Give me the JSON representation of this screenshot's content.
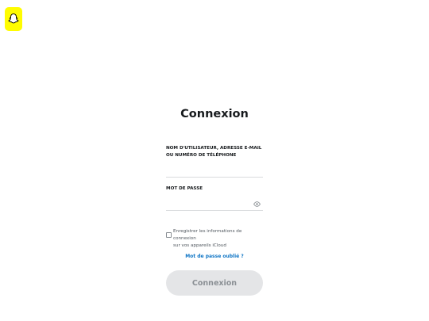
{
  "brand": {
    "icon": "snapchat-ghost-icon",
    "color": "#fffc00"
  },
  "title": "Connexion",
  "username": {
    "label_line1": "NOM D'UTILISATEUR, ADRESSE E-MAIL",
    "label_line2": "OU NUMÉRO DE TÉLÉPHONE",
    "value": ""
  },
  "password": {
    "label": "MOT DE PASSE",
    "value": "",
    "toggle_icon": "eye-icon"
  },
  "remember": {
    "checked": false,
    "label_line1": "Enregistrer les informations de connexion",
    "label_line2": "sur vos appareils iCloud"
  },
  "forgot_link": "Mot de passe oublié ?",
  "submit_label": "Connexion",
  "colors": {
    "link": "#0f75c5",
    "button_bg": "#e4e5e7",
    "button_text": "#8a8f94"
  }
}
